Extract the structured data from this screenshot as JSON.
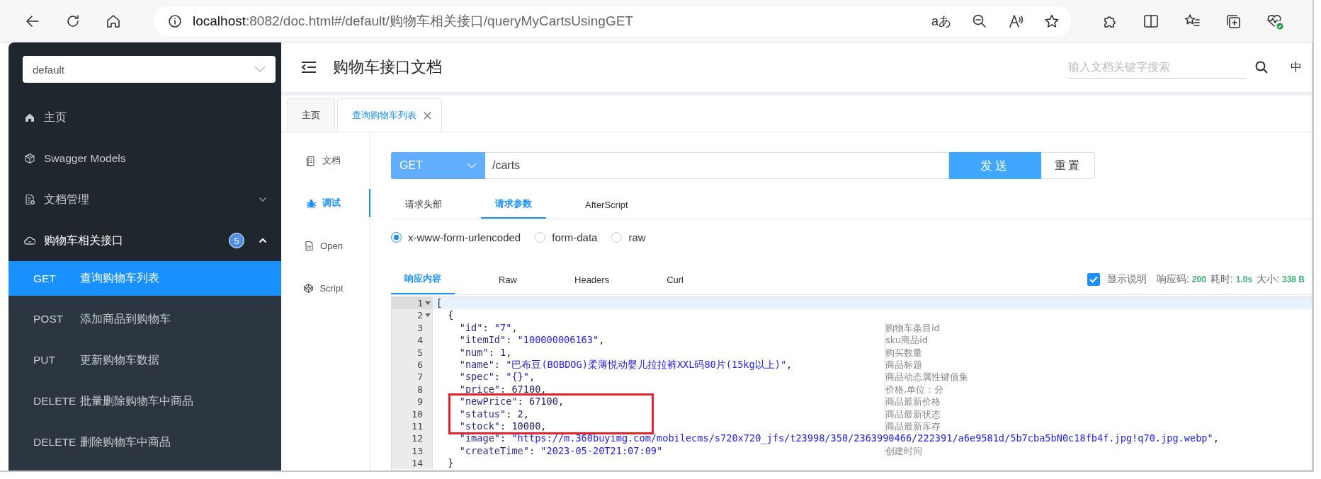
{
  "browser": {
    "address": {
      "host": "localhost",
      "path": ":8082/doc.html#/default/购物车相关接口/queryMyCartsUsingGET"
    },
    "reader_glyph": "aあ"
  },
  "sidebar": {
    "group_select": {
      "value": "default"
    },
    "items": [
      {
        "kind": "home",
        "label": "主页"
      },
      {
        "kind": "models",
        "label": "Swagger Models"
      },
      {
        "kind": "docs",
        "label": "文档管理",
        "expanded": false
      },
      {
        "kind": "api",
        "label": "购物车相关接口",
        "badge": "5",
        "expanded": true,
        "children": [
          {
            "method": "GET",
            "label": "查询购物车列表",
            "selected": true
          },
          {
            "method": "POST",
            "label": "添加商品到购物车",
            "selected": false
          },
          {
            "method": "PUT",
            "label": "更新购物车数据",
            "selected": false
          },
          {
            "method": "DELETE",
            "label": "批量删除购物车中商品",
            "selected": false
          },
          {
            "method": "DELETE",
            "label": "删除购物车中商品",
            "selected": false
          }
        ]
      }
    ]
  },
  "header": {
    "title": "购物车接口文档",
    "search": {
      "placeholder": "输入文档关键字搜索"
    },
    "language": "中"
  },
  "tabs": [
    {
      "label": "主页",
      "selected": false,
      "closable": false
    },
    {
      "label": "查询购物车列表",
      "selected": true,
      "closable": true
    }
  ],
  "side_nav": [
    {
      "kind": "doc",
      "label": "文档",
      "selected": false
    },
    {
      "kind": "debug",
      "label": "调试",
      "selected": true
    },
    {
      "kind": "open",
      "label": "Open",
      "selected": false
    },
    {
      "kind": "script",
      "label": "Script",
      "selected": false
    }
  ],
  "request": {
    "method": "GET",
    "url": "/carts",
    "send": "发送",
    "reset": "重置"
  },
  "request_tabs": [
    {
      "label": "请求头部",
      "selected": false
    },
    {
      "label": "请求参数",
      "selected": true
    },
    {
      "label": "AfterScript",
      "selected": false
    }
  ],
  "body_types": [
    {
      "label": "x-www-form-urlencoded",
      "selected": true
    },
    {
      "label": "form-data",
      "selected": false
    },
    {
      "label": "raw",
      "selected": false
    }
  ],
  "response_tabs": [
    {
      "label": "响应内容",
      "selected": true
    },
    {
      "label": "Raw",
      "selected": false
    },
    {
      "label": "Headers",
      "selected": false
    },
    {
      "label": "Curl",
      "selected": false
    }
  ],
  "response_meta": {
    "show_notes": {
      "label": "显示说明",
      "checked": true
    },
    "code_label": "响应码:",
    "code": "200",
    "time_label": "耗时:",
    "time": "1.0s",
    "size_label": "大小:",
    "size": "338 B"
  },
  "code": {
    "lines": [
      {
        "number": "1",
        "fold": true,
        "active": true,
        "highlighted": false,
        "tokens": [
          {
            "kind": "punct",
            "text": "["
          }
        ],
        "children": [
          {
            "number": "2",
            "fold": true,
            "active": false,
            "highlighted": false,
            "tokens": [
              {
                "kind": "punct",
                "text": "{"
              }
            ],
            "children": [
              {
                "number": "3",
                "active": false,
                "highlighted": false,
                "tokens": [
                  {
                    "kind": "key",
                    "text": "\"id\""
                  },
                  {
                    "kind": "punct",
                    "text": ": "
                  },
                  {
                    "kind": "string",
                    "text": "\"7\""
                  },
                  {
                    "kind": "punct",
                    "text": ","
                  }
                ],
                "comment": "购物车条目id"
              },
              {
                "number": "4",
                "active": false,
                "highlighted": false,
                "tokens": [
                  {
                    "kind": "key",
                    "text": "\"itemId\""
                  },
                  {
                    "kind": "punct",
                    "text": ": "
                  },
                  {
                    "kind": "string",
                    "text": "\"100000006163\""
                  },
                  {
                    "kind": "punct",
                    "text": ","
                  }
                ],
                "comment": "sku商品id"
              },
              {
                "number": "5",
                "active": false,
                "highlighted": false,
                "tokens": [
                  {
                    "kind": "key",
                    "text": "\"num\""
                  },
                  {
                    "kind": "punct",
                    "text": ": "
                  },
                  {
                    "kind": "number",
                    "text": "1"
                  },
                  {
                    "kind": "punct",
                    "text": ","
                  }
                ],
                "comment": "购买数量"
              },
              {
                "number": "6",
                "active": false,
                "highlighted": false,
                "tokens": [
                  {
                    "kind": "key",
                    "text": "\"name\""
                  },
                  {
                    "kind": "punct",
                    "text": ": "
                  },
                  {
                    "kind": "string",
                    "text": "\"巴布豆(BOBDOG)柔薄悦动婴儿拉拉裤XXL码80片(15kg以上)\""
                  },
                  {
                    "kind": "punct",
                    "text": ","
                  }
                ],
                "comment": "商品标题"
              },
              {
                "number": "7",
                "active": false,
                "highlighted": false,
                "tokens": [
                  {
                    "kind": "key",
                    "text": "\"spec\""
                  },
                  {
                    "kind": "punct",
                    "text": ": "
                  },
                  {
                    "kind": "string",
                    "text": "\"{}\""
                  },
                  {
                    "kind": "punct",
                    "text": ","
                  }
                ],
                "comment": "商品动态属性键值集"
              },
              {
                "number": "8",
                "active": false,
                "highlighted": false,
                "tokens": [
                  {
                    "kind": "key",
                    "text": "\"price\""
                  },
                  {
                    "kind": "punct",
                    "text": ": "
                  },
                  {
                    "kind": "number",
                    "text": "67100"
                  },
                  {
                    "kind": "punct",
                    "text": ","
                  }
                ],
                "comment": "价格,单位：分"
              },
              {
                "number": "9",
                "active": false,
                "highlighted": true,
                "tokens": [
                  {
                    "kind": "key",
                    "text": "\"newPrice\""
                  },
                  {
                    "kind": "punct",
                    "text": ": "
                  },
                  {
                    "kind": "number",
                    "text": "67100"
                  },
                  {
                    "kind": "punct",
                    "text": ","
                  }
                ],
                "comment": "商品最新价格"
              },
              {
                "number": "10",
                "active": false,
                "highlighted": true,
                "tokens": [
                  {
                    "kind": "key",
                    "text": "\"status\""
                  },
                  {
                    "kind": "punct",
                    "text": ": "
                  },
                  {
                    "kind": "number",
                    "text": "2"
                  },
                  {
                    "kind": "punct",
                    "text": ","
                  }
                ],
                "comment": "商品最新状态"
              },
              {
                "number": "11",
                "active": false,
                "highlighted": true,
                "tokens": [
                  {
                    "kind": "key",
                    "text": "\"stock\""
                  },
                  {
                    "kind": "punct",
                    "text": ": "
                  },
                  {
                    "kind": "number",
                    "text": "10000"
                  },
                  {
                    "kind": "punct",
                    "text": ","
                  }
                ],
                "comment": "商品最新库存"
              },
              {
                "number": "12",
                "active": false,
                "highlighted": false,
                "tokens": [
                  {
                    "kind": "key",
                    "text": "\"image\""
                  },
                  {
                    "kind": "punct",
                    "text": ": "
                  },
                  {
                    "kind": "string",
                    "text": "\"https://m.360buyimg.com/mobilecms/s720x720_jfs/t23998/350/2363990466/222391/a6e9581d/5b7cba5bN0c18fb4f.jpg!q70.jpg.webp\""
                  },
                  {
                    "kind": "punct",
                    "text": ","
                  }
                ]
              },
              {
                "number": "13",
                "active": false,
                "highlighted": false,
                "tokens": [
                  {
                    "kind": "key",
                    "text": "\"createTime\""
                  },
                  {
                    "kind": "punct",
                    "text": ": "
                  },
                  {
                    "kind": "string",
                    "text": "\"2023-05-20T21:07:09\""
                  }
                ],
                "comment": "创建时间"
              }
            ]
          },
          {
            "number": "14",
            "active": false,
            "highlighted": false,
            "tokens": [
              {
                "kind": "punct",
                "text": "}"
              }
            ]
          }
        ]
      }
    ]
  }
}
